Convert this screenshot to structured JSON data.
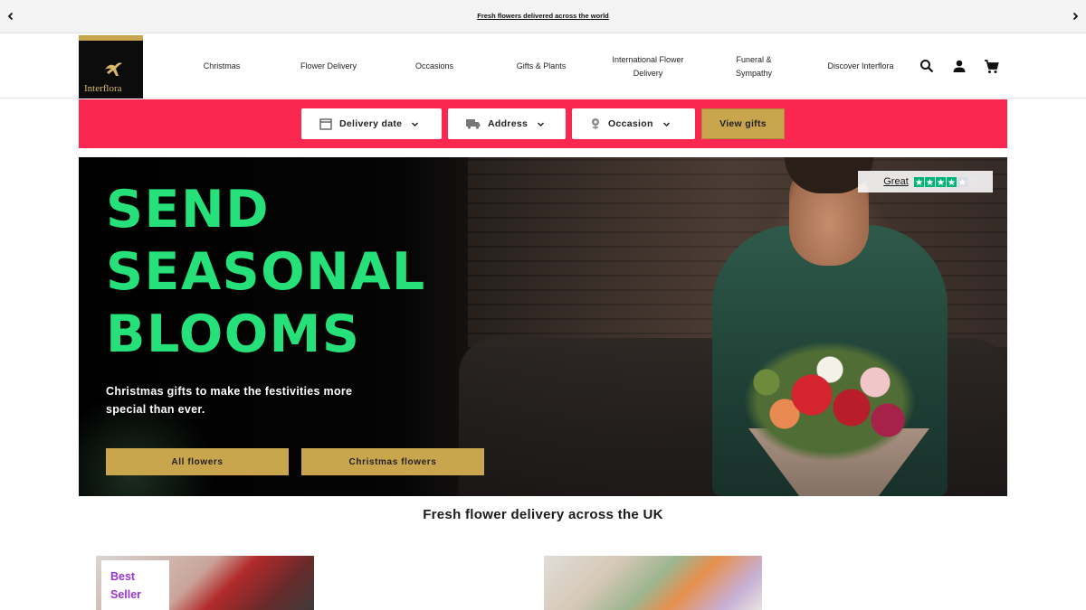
{
  "announcement": {
    "text": "Fresh flowers delivered across the world"
  },
  "brand": {
    "name": "Interflora",
    "accent_gold": "#c9a54e",
    "accent_red": "#fa2750",
    "hero_green": "#26e07a"
  },
  "nav": {
    "items": [
      {
        "label": "Christmas"
      },
      {
        "label": "Flower Delivery"
      },
      {
        "label": "Occasions"
      },
      {
        "label": "Gifts & Plants"
      },
      {
        "label": "International Flower Delivery"
      },
      {
        "label": "Funeral & Sympathy"
      },
      {
        "label": "Discover Interflora"
      }
    ],
    "icons": [
      "search-icon",
      "account-icon",
      "cart-icon"
    ]
  },
  "finder": {
    "delivery_date": "Delivery date",
    "address": "Address",
    "occasion": "Occasion",
    "cta": "View gifts"
  },
  "hero": {
    "headline": [
      "SEND",
      "SEASONAL",
      "BLOOMS"
    ],
    "subtext": "Christmas gifts to make the festivities more special than ever.",
    "buttons": [
      "All flowers",
      "Christmas flowers"
    ],
    "trustpilot": {
      "label": "Great",
      "stars": 4,
      "max": 5
    }
  },
  "section": {
    "title": "Fresh flower delivery across the UK"
  },
  "products": [
    {
      "badge": [
        "Best",
        "Seller"
      ]
    },
    {
      "badge": []
    }
  ]
}
